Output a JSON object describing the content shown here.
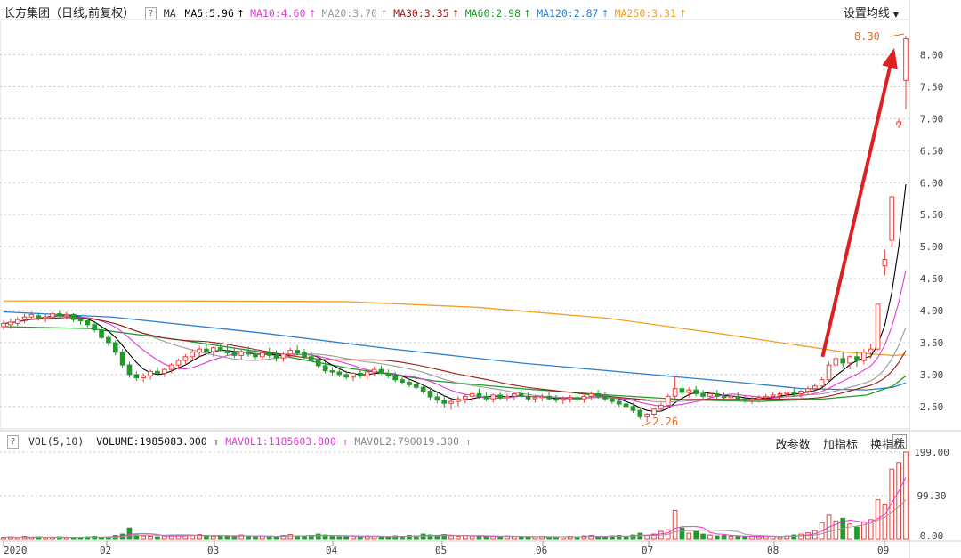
{
  "header": {
    "title": "长方集团（日线,前复权）",
    "ma_label": "MA",
    "ma": [
      {
        "label": "MA5:5.96",
        "color": "#000000",
        "arrow": "↑"
      },
      {
        "label": "MA10:4.60",
        "color": "#e23ad8",
        "arrow": "↑"
      },
      {
        "label": "MA20:3.70",
        "color": "#9a9a9a",
        "arrow": "↑"
      },
      {
        "label": "MA30:3.35",
        "color": "#9a1a1a",
        "arrow": "↑"
      },
      {
        "label": "MA60:2.98",
        "color": "#1f9b2a",
        "arrow": "↑"
      },
      {
        "label": "MA120:2.87",
        "color": "#2a7fd0",
        "arrow": "↑"
      },
      {
        "label": "MA250:3.31",
        "color": "#f0a020",
        "arrow": "↑"
      }
    ],
    "settings_label": "设置均线",
    "help": "?"
  },
  "volume_panel": {
    "label": "VOL(5,10)",
    "volume": "VOLUME:1985083.000",
    "mavol1": "MAVOL1:1185603.800",
    "mavol2": "MAVOL2:790019.300",
    "actions": [
      "改参数",
      "加指标",
      "换指标"
    ],
    "close": "✕",
    "help": "?"
  },
  "chart_data": {
    "type": "candlestick",
    "price_axis": {
      "ticks": [
        2.5,
        3.0,
        3.5,
        4.0,
        4.5,
        5.0,
        5.5,
        6.0,
        6.5,
        7.0,
        7.5,
        8.0
      ],
      "tick_labels": [
        "2.50",
        "3.00",
        "3.50",
        "4.00",
        "4.50",
        "5.00",
        "5.50",
        "6.00",
        "6.50",
        "7.00",
        "7.50",
        "8.00"
      ],
      "ylim": [
        2.15,
        8.55
      ]
    },
    "volume_axis": {
      "tick_labels": [
        "0.00",
        "99.30",
        "199.00"
      ],
      "ticks": [
        0,
        99.3,
        199.0
      ],
      "ylim": [
        0,
        205
      ]
    },
    "months": [
      "2020",
      "02",
      "03",
      "04",
      "05",
      "06",
      "07",
      "08",
      "09"
    ],
    "annotations": {
      "high": "8.30",
      "low": "2.26"
    },
    "ma_lines": {
      "MA250": [
        [
          0,
          4.15
        ],
        [
          40,
          4.15
        ],
        [
          80,
          4.14
        ],
        [
          110,
          4.05
        ],
        [
          140,
          3.88
        ],
        [
          165,
          3.65
        ],
        [
          185,
          3.45
        ],
        [
          195,
          3.35
        ],
        [
          206,
          3.3
        ],
        [
          209,
          3.31
        ]
      ],
      "MA120": [
        [
          0,
          3.98
        ],
        [
          25,
          3.9
        ],
        [
          60,
          3.65
        ],
        [
          90,
          3.4
        ],
        [
          120,
          3.18
        ],
        [
          150,
          3.0
        ],
        [
          170,
          2.88
        ],
        [
          185,
          2.78
        ],
        [
          200,
          2.76
        ],
        [
          206,
          2.8
        ],
        [
          209,
          2.87
        ]
      ],
      "MA60": [
        [
          0,
          3.75
        ],
        [
          20,
          3.72
        ],
        [
          40,
          3.55
        ],
        [
          60,
          3.35
        ],
        [
          80,
          3.1
        ],
        [
          100,
          2.9
        ],
        [
          120,
          2.78
        ],
        [
          140,
          2.68
        ],
        [
          160,
          2.6
        ],
        [
          175,
          2.58
        ],
        [
          190,
          2.62
        ],
        [
          200,
          2.68
        ],
        [
          206,
          2.82
        ],
        [
          209,
          2.98
        ]
      ]
    },
    "candles": [
      [
        0,
        3.75,
        3.85,
        3.7,
        3.8
      ],
      [
        1,
        3.78,
        3.88,
        3.72,
        3.82
      ],
      [
        2,
        3.8,
        3.9,
        3.76,
        3.86
      ],
      [
        3,
        3.86,
        3.95,
        3.8,
        3.9
      ],
      [
        4,
        3.9,
        3.98,
        3.85,
        3.94
      ],
      [
        5,
        3.92,
        3.96,
        3.84,
        3.88
      ],
      [
        6,
        3.88,
        3.94,
        3.82,
        3.9
      ],
      [
        7,
        3.9,
        3.98,
        3.86,
        3.95
      ],
      [
        8,
        3.95,
        4.0,
        3.88,
        3.92
      ],
      [
        9,
        3.92,
        3.98,
        3.86,
        3.94
      ],
      [
        10,
        3.94,
        3.96,
        3.82,
        3.86
      ],
      [
        11,
        3.86,
        3.9,
        3.78,
        3.84
      ],
      [
        12,
        3.84,
        3.88,
        3.74,
        3.78
      ],
      [
        13,
        3.78,
        3.82,
        3.66,
        3.7
      ],
      [
        14,
        3.7,
        3.74,
        3.55,
        3.58
      ],
      [
        15,
        3.58,
        3.62,
        3.45,
        3.5
      ],
      [
        16,
        3.5,
        3.54,
        3.3,
        3.35
      ],
      [
        17,
        3.35,
        3.4,
        3.1,
        3.15
      ],
      [
        18,
        3.15,
        3.2,
        2.95,
        3.0
      ],
      [
        19,
        3.0,
        3.05,
        2.9,
        2.95
      ],
      [
        20,
        2.95,
        3.02,
        2.88,
        2.98
      ],
      [
        21,
        2.98,
        3.08,
        2.92,
        3.05
      ],
      [
        22,
        3.05,
        3.12,
        2.98,
        3.02
      ],
      [
        23,
        3.02,
        3.1,
        2.96,
        3.08
      ],
      [
        24,
        3.08,
        3.18,
        3.02,
        3.15
      ],
      [
        25,
        3.15,
        3.25,
        3.08,
        3.22
      ],
      [
        26,
        3.22,
        3.32,
        3.15,
        3.28
      ],
      [
        27,
        3.28,
        3.4,
        3.22,
        3.35
      ],
      [
        28,
        3.35,
        3.45,
        3.28,
        3.4
      ],
      [
        29,
        3.4,
        3.48,
        3.32,
        3.36
      ],
      [
        30,
        3.36,
        3.44,
        3.28,
        3.42
      ],
      [
        31,
        3.42,
        3.5,
        3.35,
        3.38
      ],
      [
        32,
        3.38,
        3.46,
        3.3,
        3.34
      ],
      [
        33,
        3.34,
        3.42,
        3.26,
        3.3
      ],
      [
        34,
        3.3,
        3.4,
        3.22,
        3.36
      ],
      [
        35,
        3.36,
        3.44,
        3.28,
        3.32
      ],
      [
        36,
        3.32,
        3.4,
        3.24,
        3.28
      ],
      [
        37,
        3.28,
        3.38,
        3.22,
        3.34
      ],
      [
        38,
        3.34,
        3.42,
        3.26,
        3.3
      ],
      [
        39,
        3.3,
        3.38,
        3.2,
        3.26
      ],
      [
        40,
        3.26,
        3.36,
        3.2,
        3.32
      ],
      [
        41,
        3.32,
        3.42,
        3.26,
        3.38
      ],
      [
        42,
        3.38,
        3.46,
        3.3,
        3.34
      ],
      [
        43,
        3.34,
        3.4,
        3.24,
        3.28
      ],
      [
        44,
        3.28,
        3.36,
        3.2,
        3.22
      ],
      [
        45,
        3.22,
        3.3,
        3.1,
        3.14
      ],
      [
        46,
        3.14,
        3.2,
        3.02,
        3.06
      ],
      [
        47,
        3.06,
        3.12,
        2.98,
        3.04
      ],
      [
        48,
        3.04,
        3.1,
        2.96,
        3.0
      ],
      [
        49,
        3.0,
        3.06,
        2.92,
        2.96
      ],
      [
        50,
        2.96,
        3.04,
        2.9,
        3.02
      ],
      [
        51,
        3.02,
        3.08,
        2.94,
        2.98
      ],
      [
        52,
        2.98,
        3.06,
        2.92,
        3.04
      ],
      [
        53,
        3.04,
        3.12,
        2.98,
        3.08
      ],
      [
        54,
        3.08,
        3.14,
        3.0,
        3.02
      ],
      [
        55,
        3.02,
        3.08,
        2.94,
        2.98
      ],
      [
        56,
        2.98,
        3.04,
        2.88,
        2.92
      ],
      [
        57,
        2.92,
        2.98,
        2.84,
        2.88
      ],
      [
        58,
        2.88,
        2.94,
        2.8,
        2.84
      ],
      [
        59,
        2.84,
        2.9,
        2.76,
        2.8
      ],
      [
        60,
        2.8,
        2.86,
        2.7,
        2.74
      ],
      [
        61,
        2.74,
        2.8,
        2.6,
        2.65
      ],
      [
        62,
        2.65,
        2.72,
        2.55,
        2.6
      ],
      [
        63,
        2.6,
        2.68,
        2.48,
        2.55
      ],
      [
        64,
        2.55,
        2.62,
        2.45,
        2.58
      ],
      [
        65,
        2.58,
        2.66,
        2.5,
        2.62
      ],
      [
        66,
        2.62,
        2.7,
        2.55,
        2.66
      ],
      [
        67,
        2.66,
        2.74,
        2.58,
        2.7
      ],
      [
        68,
        2.7,
        2.78,
        2.62,
        2.66
      ],
      [
        69,
        2.66,
        2.72,
        2.58,
        2.62
      ],
      [
        70,
        2.62,
        2.7,
        2.56,
        2.68
      ],
      [
        71,
        2.68,
        2.74,
        2.6,
        2.64
      ],
      [
        72,
        2.64,
        2.7,
        2.58,
        2.66
      ],
      [
        73,
        2.66,
        2.72,
        2.6,
        2.7
      ],
      [
        74,
        2.7,
        2.76,
        2.62,
        2.66
      ],
      [
        75,
        2.66,
        2.72,
        2.58,
        2.62
      ],
      [
        76,
        2.62,
        2.68,
        2.56,
        2.64
      ],
      [
        77,
        2.64,
        2.7,
        2.58,
        2.66
      ],
      [
        78,
        2.66,
        2.72,
        2.6,
        2.62
      ],
      [
        79,
        2.62,
        2.68,
        2.56,
        2.6
      ],
      [
        80,
        2.6,
        2.66,
        2.54,
        2.62
      ],
      [
        81,
        2.62,
        2.68,
        2.56,
        2.64
      ],
      [
        82,
        2.64,
        2.7,
        2.58,
        2.62
      ],
      [
        83,
        2.62,
        2.68,
        2.56,
        2.66
      ],
      [
        84,
        2.66,
        2.74,
        2.6,
        2.7
      ],
      [
        85,
        2.7,
        2.76,
        2.62,
        2.66
      ],
      [
        86,
        2.66,
        2.72,
        2.58,
        2.62
      ],
      [
        87,
        2.62,
        2.66,
        2.54,
        2.58
      ],
      [
        88,
        2.58,
        2.64,
        2.5,
        2.54
      ],
      [
        89,
        2.54,
        2.6,
        2.46,
        2.5
      ],
      [
        90,
        2.5,
        2.56,
        2.4,
        2.44
      ],
      [
        91,
        2.44,
        2.5,
        2.3,
        2.34
      ],
      [
        92,
        2.34,
        2.4,
        2.26,
        2.38
      ],
      [
        93,
        2.38,
        2.48,
        2.34,
        2.46
      ],
      [
        94,
        2.46,
        2.56,
        2.42,
        2.52
      ],
      [
        95,
        2.52,
        2.7,
        2.48,
        2.66
      ],
      [
        96,
        2.66,
        2.98,
        2.62,
        2.78
      ],
      [
        97,
        2.78,
        2.86,
        2.68,
        2.72
      ],
      [
        98,
        2.72,
        2.8,
        2.64,
        2.76
      ],
      [
        99,
        2.76,
        2.82,
        2.66,
        2.7
      ],
      [
        100,
        2.7,
        2.76,
        2.62,
        2.66
      ],
      [
        101,
        2.66,
        2.74,
        2.6,
        2.7
      ],
      [
        102,
        2.7,
        2.76,
        2.62,
        2.66
      ],
      [
        103,
        2.66,
        2.72,
        2.58,
        2.64
      ],
      [
        104,
        2.64,
        2.7,
        2.58,
        2.66
      ],
      [
        105,
        2.66,
        2.72,
        2.6,
        2.62
      ],
      [
        106,
        2.62,
        2.68,
        2.56,
        2.6
      ],
      [
        107,
        2.6,
        2.66,
        2.54,
        2.62
      ],
      [
        108,
        2.62,
        2.68,
        2.56,
        2.64
      ],
      [
        109,
        2.64,
        2.7,
        2.58,
        2.66
      ],
      [
        110,
        2.66,
        2.72,
        2.6,
        2.68
      ],
      [
        111,
        2.68,
        2.74,
        2.62,
        2.7
      ],
      [
        112,
        2.7,
        2.76,
        2.64,
        2.72
      ],
      [
        113,
        2.72,
        2.78,
        2.66,
        2.7
      ],
      [
        114,
        2.7,
        2.76,
        2.64,
        2.74
      ],
      [
        115,
        2.74,
        2.82,
        2.68,
        2.78
      ],
      [
        116,
        2.78,
        2.86,
        2.72,
        2.82
      ],
      [
        117,
        2.82,
        2.96,
        2.78,
        2.92
      ],
      [
        118,
        2.92,
        3.2,
        2.88,
        3.15
      ],
      [
        119,
        3.15,
        3.38,
        3.05,
        3.25
      ],
      [
        120,
        3.25,
        3.35,
        3.1,
        3.18
      ],
      [
        121,
        3.18,
        3.3,
        3.08,
        3.28
      ],
      [
        122,
        3.28,
        3.36,
        3.12,
        3.22
      ],
      [
        123,
        3.22,
        3.4,
        3.16,
        3.35
      ],
      [
        124,
        3.35,
        3.48,
        3.25,
        3.4
      ],
      [
        125,
        3.4,
        4.1,
        3.38,
        4.1
      ],
      [
        126,
        4.7,
        4.95,
        4.55,
        4.8
      ],
      [
        127,
        5.1,
        5.8,
        5.0,
        5.78
      ],
      [
        128,
        6.9,
        7.0,
        6.85,
        6.95
      ],
      [
        129,
        7.6,
        8.3,
        7.15,
        8.25
      ]
    ],
    "volumes": [
      [
        0,
        5
      ],
      [
        1,
        6
      ],
      [
        2,
        4
      ],
      [
        3,
        7
      ],
      [
        4,
        5
      ],
      [
        5,
        6
      ],
      [
        6,
        4
      ],
      [
        7,
        5
      ],
      [
        8,
        6
      ],
      [
        9,
        5
      ],
      [
        10,
        4
      ],
      [
        11,
        5
      ],
      [
        12,
        6
      ],
      [
        13,
        7
      ],
      [
        14,
        5
      ],
      [
        15,
        6
      ],
      [
        16,
        9
      ],
      [
        17,
        12
      ],
      [
        18,
        26
      ],
      [
        19,
        10
      ],
      [
        20,
        8
      ],
      [
        21,
        7
      ],
      [
        22,
        6
      ],
      [
        23,
        8
      ],
      [
        24,
        9
      ],
      [
        25,
        10
      ],
      [
        26,
        8
      ],
      [
        27,
        9
      ],
      [
        28,
        11
      ],
      [
        29,
        8
      ],
      [
        30,
        7
      ],
      [
        31,
        9
      ],
      [
        32,
        8
      ],
      [
        33,
        6
      ],
      [
        34,
        10
      ],
      [
        35,
        7
      ],
      [
        36,
        6
      ],
      [
        37,
        8
      ],
      [
        38,
        7
      ],
      [
        39,
        6
      ],
      [
        40,
        9
      ],
      [
        41,
        11
      ],
      [
        42,
        8
      ],
      [
        43,
        7
      ],
      [
        44,
        9
      ],
      [
        45,
        12
      ],
      [
        46,
        10
      ],
      [
        47,
        7
      ],
      [
        48,
        6
      ],
      [
        49,
        6
      ],
      [
        50,
        7
      ],
      [
        51,
        6
      ],
      [
        52,
        8
      ],
      [
        53,
        7
      ],
      [
        54,
        6
      ],
      [
        55,
        6
      ],
      [
        56,
        8
      ],
      [
        57,
        7
      ],
      [
        58,
        9
      ],
      [
        59,
        8
      ],
      [
        60,
        12
      ],
      [
        61,
        10
      ],
      [
        62,
        8
      ],
      [
        63,
        11
      ],
      [
        64,
        8
      ],
      [
        65,
        7
      ],
      [
        66,
        9
      ],
      [
        67,
        8
      ],
      [
        68,
        7
      ],
      [
        69,
        6
      ],
      [
        70,
        7
      ],
      [
        71,
        6
      ],
      [
        72,
        8
      ],
      [
        73,
        7
      ],
      [
        74,
        6
      ],
      [
        75,
        5
      ],
      [
        76,
        6
      ],
      [
        77,
        7
      ],
      [
        78,
        6
      ],
      [
        79,
        5
      ],
      [
        80,
        6
      ],
      [
        81,
        7
      ],
      [
        82,
        6
      ],
      [
        83,
        8
      ],
      [
        84,
        9
      ],
      [
        85,
        7
      ],
      [
        86,
        6
      ],
      [
        87,
        8
      ],
      [
        88,
        9
      ],
      [
        89,
        7
      ],
      [
        90,
        10
      ],
      [
        91,
        14
      ],
      [
        92,
        9
      ],
      [
        93,
        12
      ],
      [
        94,
        18
      ],
      [
        95,
        22
      ],
      [
        96,
        66
      ],
      [
        97,
        26
      ],
      [
        98,
        14
      ],
      [
        99,
        18
      ],
      [
        100,
        12
      ],
      [
        101,
        10
      ],
      [
        102,
        8
      ],
      [
        103,
        9
      ],
      [
        104,
        7
      ],
      [
        105,
        8
      ],
      [
        106,
        6
      ],
      [
        107,
        7
      ],
      [
        108,
        6
      ],
      [
        109,
        8
      ],
      [
        110,
        7
      ],
      [
        111,
        6
      ],
      [
        112,
        8
      ],
      [
        113,
        10
      ],
      [
        114,
        12
      ],
      [
        115,
        15
      ],
      [
        116,
        20
      ],
      [
        117,
        38
      ],
      [
        118,
        55
      ],
      [
        119,
        42
      ],
      [
        120,
        48
      ],
      [
        121,
        35
      ],
      [
        122,
        28
      ],
      [
        123,
        40
      ],
      [
        124,
        45
      ],
      [
        125,
        90
      ],
      [
        126,
        80
      ],
      [
        127,
        160
      ],
      [
        128,
        175
      ],
      [
        129,
        199
      ]
    ]
  }
}
